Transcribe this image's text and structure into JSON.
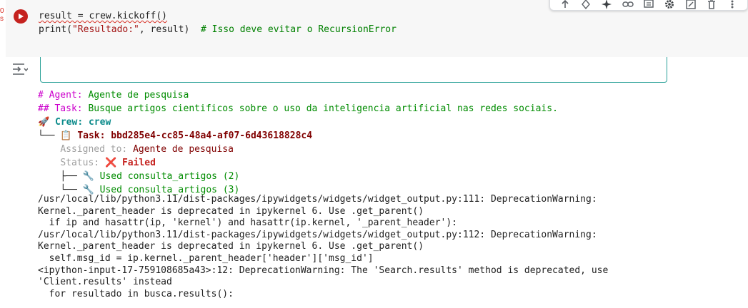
{
  "cell": {
    "code_lines": [
      {
        "a": "result = crew.kickoff()",
        "b": "",
        "c": ""
      },
      {
        "a": "print(",
        "b": "\"Resultado:\"",
        "c": ", result)  "
      }
    ],
    "comment": "# Isso deve evitar o RecursionError"
  },
  "output": {
    "agent_prefix": "# Agent: ",
    "agent_name": "Agente de pesquisa",
    "task_prefix": "## Task: ",
    "task_text": "Busque artigos cientificos sobre o uso da inteligencia artificial nas redes sociais.",
    "crew_icon": "🚀",
    "crew_label": "Crew: crew",
    "tree_branch_task": "└── ",
    "task_icon": "📋",
    "task_id": "Task: bbd285e4-cc85-48a4-af07-6d43618828c4",
    "assigned_label": "Assigned to: ",
    "assigned_value": "Agente de pesquisa",
    "status_label": "Status: ",
    "status_icon": "❌",
    "status_value": "Failed",
    "tool_branch_1": "├── ",
    "tool_branch_2": "└── ",
    "tool_icon": "🔧",
    "tool_1": "Used consulta_artigos (2)",
    "tool_2": "Used consulta_artigos (3)"
  },
  "warnings": [
    "/usr/local/lib/python3.11/dist-packages/ipywidgets/widgets/widget_output.py:111: DeprecationWarning:",
    "Kernel._parent_header is deprecated in ipykernel 6. Use .get_parent()",
    "  if ip and hasattr(ip, 'kernel') and hasattr(ip.kernel, '_parent_header'):",
    "/usr/local/lib/python3.11/dist-packages/ipywidgets/widgets/widget_output.py:112: DeprecationWarning:",
    "Kernel._parent_header is deprecated in ipykernel 6. Use .get_parent()",
    "  self.msg_id = ip.kernel._parent_header['header']['msg_id']",
    "<ipython-input-17-759108685a43>:12: DeprecationWarning: The 'Search.results' method is deprecated, use",
    "'Client.results' instead",
    "  for resultado in busca.results():"
  ],
  "left_strip_text": "0\ns",
  "colors": {
    "run": "#c5221f",
    "accent_teal": "#2aa198"
  }
}
